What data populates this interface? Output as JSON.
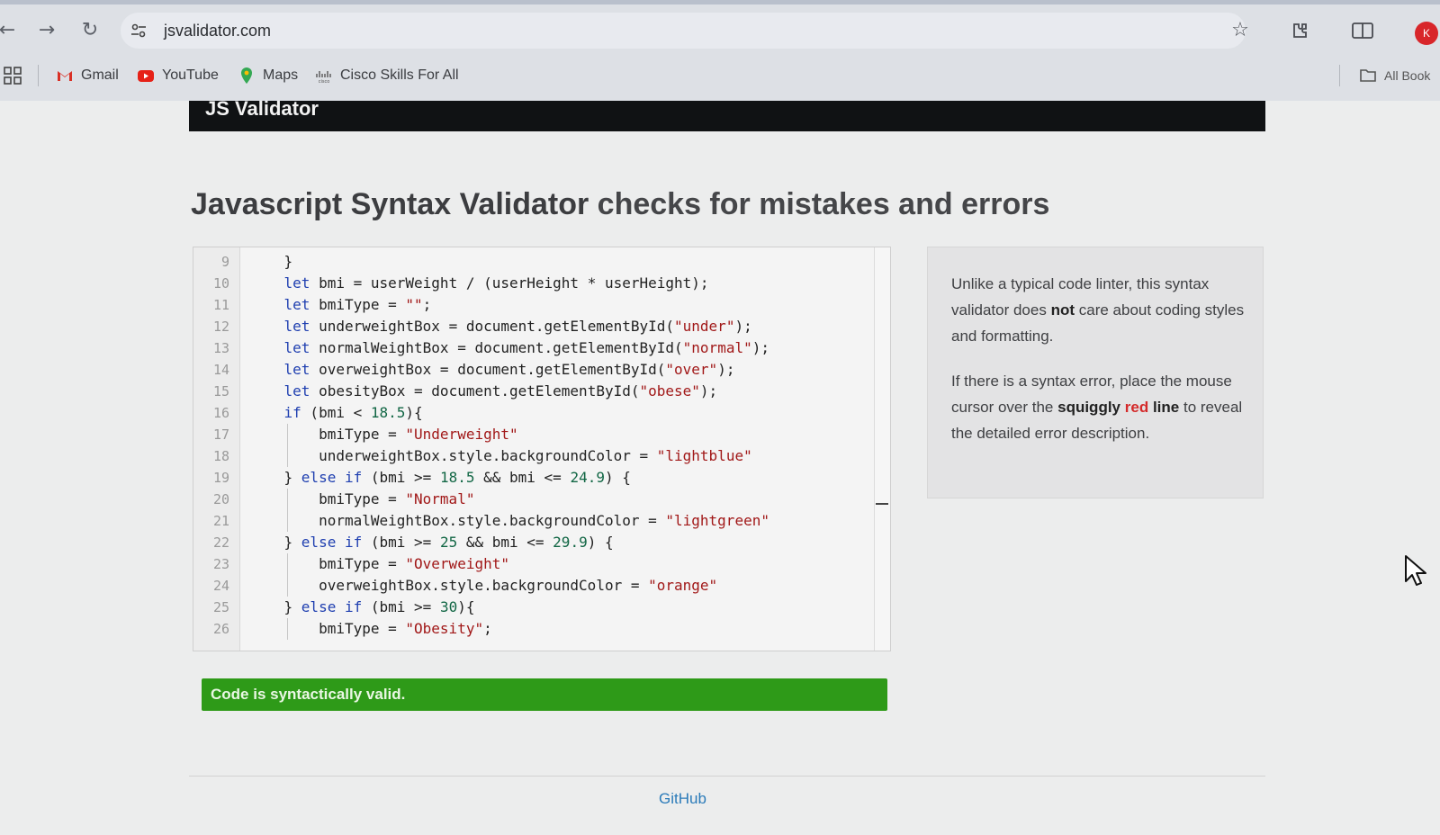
{
  "browser": {
    "url": "jsvalidator.com",
    "bookmarks": [
      {
        "label": "Gmail",
        "icon": "gmail-icon"
      },
      {
        "label": "YouTube",
        "icon": "youtube-icon"
      },
      {
        "label": "Maps",
        "icon": "maps-icon"
      },
      {
        "label": "Cisco Skills For All",
        "icon": "cisco-icon"
      }
    ],
    "all_bookmarks_label": "All Book"
  },
  "site": {
    "header_title": "JS Validator",
    "headline_strong": "Javascript Syntax Validator",
    "headline_rest": " checks for mistakes and errors"
  },
  "editor": {
    "lines": [
      {
        "n": "9"
      },
      {
        "n": "10"
      },
      {
        "n": "11"
      },
      {
        "n": "12"
      },
      {
        "n": "13"
      },
      {
        "n": "14"
      },
      {
        "n": "15"
      },
      {
        "n": "16"
      },
      {
        "n": "17"
      },
      {
        "n": "18"
      },
      {
        "n": "19"
      },
      {
        "n": "20"
      },
      {
        "n": "21"
      },
      {
        "n": "22"
      },
      {
        "n": "23"
      },
      {
        "n": "24"
      },
      {
        "n": "25"
      },
      {
        "n": "26"
      }
    ],
    "code": [
      [
        [
          "p",
          "    }"
        ]
      ],
      [
        [
          "p",
          "    "
        ],
        [
          "k",
          "let"
        ],
        [
          "p",
          " bmi = userWeight / (userHeight * userHeight);"
        ]
      ],
      [
        [
          "p",
          "    "
        ],
        [
          "k",
          "let"
        ],
        [
          "p",
          " bmiType = "
        ],
        [
          "s",
          "\"\""
        ],
        [
          "p",
          ";"
        ]
      ],
      [
        [
          "p",
          "    "
        ],
        [
          "k",
          "let"
        ],
        [
          "p",
          " underweightBox = document.getElementById("
        ],
        [
          "s",
          "\"under\""
        ],
        [
          "p",
          ");"
        ]
      ],
      [
        [
          "p",
          "    "
        ],
        [
          "k",
          "let"
        ],
        [
          "p",
          " normalWeightBox = document.getElementById("
        ],
        [
          "s",
          "\"normal\""
        ],
        [
          "p",
          ");"
        ]
      ],
      [
        [
          "p",
          "    "
        ],
        [
          "k",
          "let"
        ],
        [
          "p",
          " overweightBox = document.getElementById("
        ],
        [
          "s",
          "\"over\""
        ],
        [
          "p",
          ");"
        ]
      ],
      [
        [
          "p",
          "    "
        ],
        [
          "k",
          "let"
        ],
        [
          "p",
          " obesityBox = document.getElementById("
        ],
        [
          "s",
          "\"obese\""
        ],
        [
          "p",
          ");"
        ]
      ],
      [
        [
          "p",
          "    "
        ],
        [
          "k",
          "if"
        ],
        [
          "p",
          " (bmi < "
        ],
        [
          "n",
          "18.5"
        ],
        [
          "p",
          "){"
        ]
      ],
      [
        [
          "p",
          "        bmiType = "
        ],
        [
          "s",
          "\"Underweight\""
        ]
      ],
      [
        [
          "p",
          "        underweightBox.style.backgroundColor = "
        ],
        [
          "s",
          "\"lightblue\""
        ]
      ],
      [
        [
          "p",
          "    } "
        ],
        [
          "k",
          "else if"
        ],
        [
          "p",
          " (bmi >= "
        ],
        [
          "n",
          "18.5"
        ],
        [
          "p",
          " && bmi <= "
        ],
        [
          "n",
          "24.9"
        ],
        [
          "p",
          ") {"
        ]
      ],
      [
        [
          "p",
          "        bmiType = "
        ],
        [
          "s",
          "\"Normal\""
        ]
      ],
      [
        [
          "p",
          "        normalWeightBox.style.backgroundColor = "
        ],
        [
          "s",
          "\"lightgreen\""
        ]
      ],
      [
        [
          "p",
          "    } "
        ],
        [
          "k",
          "else if"
        ],
        [
          "p",
          " (bmi >= "
        ],
        [
          "n",
          "25"
        ],
        [
          "p",
          " && bmi <= "
        ],
        [
          "n",
          "29.9"
        ],
        [
          "p",
          ") {"
        ]
      ],
      [
        [
          "p",
          "        bmiType = "
        ],
        [
          "s",
          "\"Overweight\""
        ]
      ],
      [
        [
          "p",
          "        overweightBox.style.backgroundColor = "
        ],
        [
          "s",
          "\"orange\""
        ]
      ],
      [
        [
          "p",
          "    } "
        ],
        [
          "k",
          "else if"
        ],
        [
          "p",
          " (bmi >= "
        ],
        [
          "n",
          "30"
        ],
        [
          "p",
          "){"
        ]
      ],
      [
        [
          "p",
          "        bmiType = "
        ],
        [
          "s",
          "\"Obesity\""
        ],
        [
          "p",
          ";"
        ]
      ]
    ]
  },
  "info": {
    "p1_a": "Unlike a typical code linter, this syntax validator does ",
    "p1_b": "not",
    "p1_c": " care about coding styles and formatting.",
    "p2_a": "If there is a syntax error, place the mouse cursor over the ",
    "p2_b": "squiggly",
    "p2_c": "red",
    "p2_d": "line",
    "p2_e": " to reveal the detailed error description."
  },
  "status": {
    "text": "Code is syntactically valid.",
    "color": "#2e9a18"
  },
  "footer": {
    "github_label": "GitHub"
  },
  "colors": {
    "keyword": "#1f3fb0",
    "string": "#a11818",
    "number": "#116644"
  }
}
